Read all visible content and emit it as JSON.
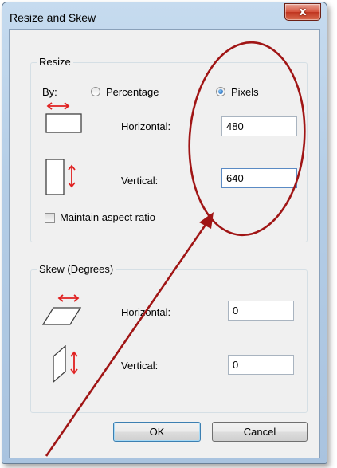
{
  "window": {
    "title": "Resize and Skew",
    "close_glyph": "x"
  },
  "resize": {
    "group_label": "Resize",
    "by_label": "By:",
    "options": [
      {
        "label": "Percentage",
        "checked": false
      },
      {
        "label": "Pixels",
        "checked": true
      }
    ],
    "horizontal_label": "Horizontal:",
    "horizontal_value": "480",
    "vertical_label": "Vertical:",
    "vertical_value": "640",
    "maintain_label": "Maintain aspect ratio",
    "maintain_checked": false
  },
  "skew": {
    "group_label": "Skew (Degrees)",
    "horizontal_label": "Horizontal:",
    "horizontal_value": "0",
    "vertical_label": "Vertical:",
    "vertical_value": "0"
  },
  "buttons": {
    "ok": "OK",
    "cancel": "Cancel"
  },
  "colors": {
    "arrow_icon": "#e02020",
    "annotation": "#a01515"
  }
}
